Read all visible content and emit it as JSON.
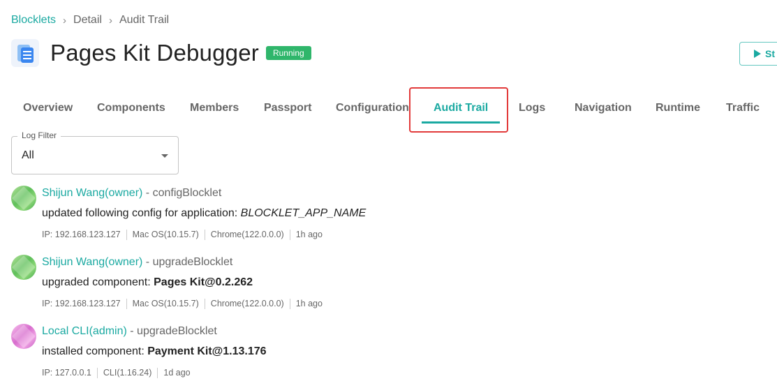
{
  "breadcrumb": {
    "items": [
      "Blocklets",
      "Detail",
      "Audit Trail"
    ],
    "separator": "›"
  },
  "app": {
    "title": "Pages Kit Debugger",
    "status": "Running",
    "icon": "app-pages-icon",
    "start_label": "St"
  },
  "tabs": [
    {
      "label": "Overview"
    },
    {
      "label": "Components"
    },
    {
      "label": "Members"
    },
    {
      "label": "Passport"
    },
    {
      "label": "Configuration"
    },
    {
      "label": "Audit Trail",
      "active": true
    },
    {
      "label": "Logs"
    },
    {
      "label": "Navigation"
    },
    {
      "label": "Runtime"
    },
    {
      "label": "Traffic"
    }
  ],
  "filter": {
    "label": "Log Filter",
    "value": "All"
  },
  "entries": [
    {
      "user": "Shijun Wang(owner)",
      "separator": " - ",
      "action": "configBlocklet",
      "message": "updated following config for application: ",
      "detail": "BLOCKLET_APP_NAME",
      "meta": [
        "IP: 192.168.123.127",
        "Mac OS(10.15.7)",
        "Chrome(122.0.0.0)",
        "1h ago"
      ]
    },
    {
      "user": "Shijun Wang(owner)",
      "separator": " - ",
      "action": "upgradeBlocklet",
      "message": "upgraded component: ",
      "detail": "Pages Kit@0.2.262",
      "meta": [
        "IP: 192.168.123.127",
        "Mac OS(10.15.7)",
        "Chrome(122.0.0.0)",
        "1h ago"
      ]
    },
    {
      "user": "Local CLI(admin)",
      "separator": " - ",
      "action": "upgradeBlocklet",
      "message": "installed component: ",
      "detail": "Payment Kit@1.13.176",
      "meta": [
        "IP: 127.0.0.1",
        "CLI(1.16.24)",
        "1d ago"
      ]
    }
  ],
  "colors": {
    "accent": "#1aa9a1",
    "status_running": "#2fb66b",
    "highlight": "#e23a3a"
  }
}
